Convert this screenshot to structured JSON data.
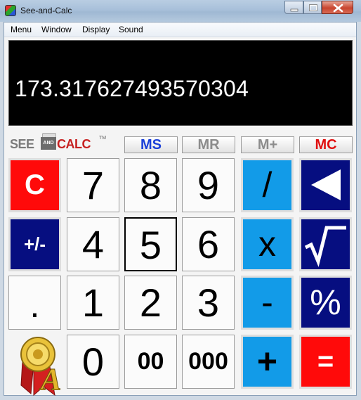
{
  "window": {
    "title": "See-and-Calc"
  },
  "menu": [
    "Menu",
    "Window",
    "Display",
    "Sound"
  ],
  "display": {
    "value": "173.317627493570304"
  },
  "logo": {
    "see": "SEE",
    "and": "AND",
    "calc": "CALC",
    "tm": "TM"
  },
  "memory": [
    {
      "label": "MS",
      "color": "#1a3fd8"
    },
    {
      "label": "MR",
      "color": "#8c8c8c"
    },
    {
      "label": "M+",
      "color": "#8c8c8c"
    },
    {
      "label": "MC",
      "color": "#e01010"
    }
  ],
  "keys": {
    "clear": "C",
    "seven": "7",
    "eight": "8",
    "nine": "9",
    "divide": "/",
    "plusminus": "+/-",
    "four": "4",
    "five": "5",
    "six": "6",
    "multiply": "x",
    "decimal": ".",
    "one": "1",
    "two": "2",
    "three": "3",
    "minus": "-",
    "percent": "%",
    "zero": "0",
    "double_zero": "00",
    "triple_zero": "000",
    "plus": "+",
    "equals": "="
  },
  "icons": {
    "backspace": "left-triangle-icon",
    "sqrt": "square-root-icon",
    "award": "award-ribbon-icon"
  },
  "colors": {
    "red": "#ff0a0a",
    "navy": "#060e80",
    "blue": "#129be8"
  }
}
